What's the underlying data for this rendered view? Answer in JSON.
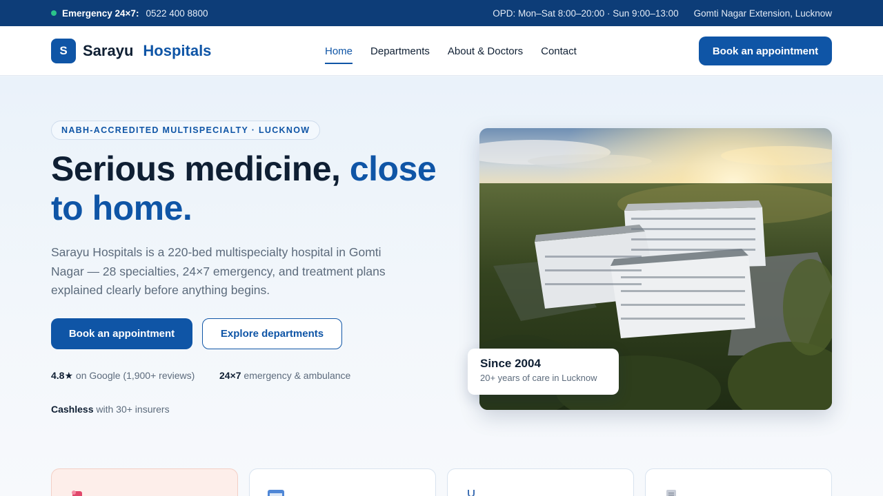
{
  "topbar": {
    "emergency_label": "Emergency 24×7:",
    "emergency_phone": "0522 400 8800",
    "opd_hours": "OPD: Mon–Sat 8:00–20:00 · Sun 9:00–13:00",
    "location": "Gomti Nagar Extension, Lucknow",
    "status_color": "#2bc48a"
  },
  "nav": {
    "logo_letter": "S",
    "brand_primary": "Sarayu",
    "brand_secondary": "Hospitals",
    "items": [
      {
        "label": "Home",
        "active": true
      },
      {
        "label": "Departments",
        "active": false
      },
      {
        "label": "About & Doctors",
        "active": false
      },
      {
        "label": "Contact",
        "active": false
      }
    ],
    "cta_label": "Book an appointment"
  },
  "hero": {
    "badge": "NABH-ACCREDITED MULTISPECIALTY · LUCKNOW",
    "headline_part1": "Serious medicine, ",
    "headline_accent": "close to home.",
    "lead": "Sarayu Hospitals is a 220-bed multispecialty hospital in Gomti Nagar — 28 specialties, 24×7 emergency, and treatment plans explained clearly before anything begins.",
    "primary_button": "Book an appointment",
    "secondary_button": "Explore departments",
    "stats": [
      {
        "strong": "4.8★",
        "text": " on Google (1,900+ reviews)"
      },
      {
        "strong": "24×7",
        "text": " emergency & ambulance"
      },
      {
        "strong": "Cashless",
        "text": " with 30+ insurers"
      }
    ],
    "since_title": "Since 2004",
    "since_subtitle": "20+ years of care in Lucknow"
  },
  "cards": [
    {
      "icon": "heart-pulse-icon"
    },
    {
      "icon": "calendar-icon"
    },
    {
      "icon": "stethoscope-icon"
    },
    {
      "icon": "document-icon"
    }
  ],
  "colors": {
    "brand": "#0f55a6",
    "topbar": "#0d3d78",
    "text": "#0f1f33",
    "muted": "#5c6b7c"
  }
}
